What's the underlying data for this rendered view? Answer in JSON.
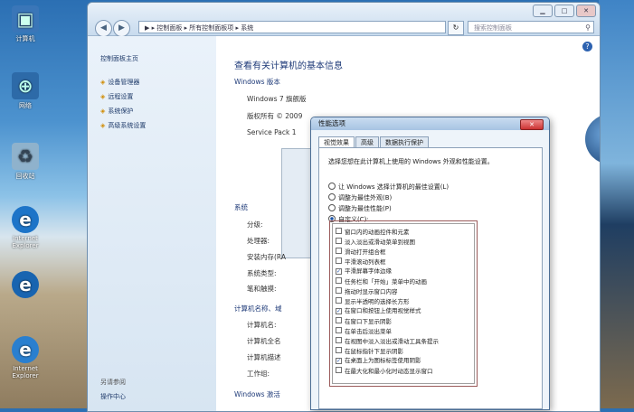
{
  "desktop": {
    "icons": [
      {
        "label": "计算机",
        "icon": "computer-icon"
      },
      {
        "label": "网络",
        "icon": "network-icon"
      },
      {
        "label": "回收站",
        "icon": "recycle-bin-icon"
      },
      {
        "label": "Internet Explorer",
        "icon": "ie-icon"
      },
      {
        "label": "",
        "icon": "ie-icon"
      },
      {
        "label": "Internet Explorer",
        "icon": "ie-icon"
      }
    ]
  },
  "window": {
    "buttons": {
      "minimize": "▁",
      "maximize": "□",
      "close": "✕"
    },
    "address": "▶ ▸ 控制面板 ▸ 所有控制面板项 ▸ 系统",
    "refresh": "↻",
    "search_placeholder": "搜索控制面板",
    "sidebar": {
      "home": "控制面板主页",
      "items": [
        "设备管理器",
        "远程设置",
        "系统保护",
        "高级系统设置"
      ],
      "see_also": "另请参阅",
      "action_center": "操作中心"
    },
    "main": {
      "title": "查看有关计算机的基本信息",
      "edition_heading": "Windows 版本",
      "edition": "Windows 7 旗舰版",
      "copyright": "版权所有 © 2009",
      "service_pack": "Service Pack 1",
      "system_heading": "系统",
      "system_rows": [
        "分级:",
        "处理器:",
        "安装内存(RA",
        "系统类型:",
        "笔和触摸:"
      ],
      "computer_heading": "计算机名称、域",
      "computer_rows": [
        "计算机名:",
        "计算机全名",
        "计算机描述",
        "工作组:"
      ],
      "activation_heading": "Windows 激活"
    }
  },
  "dialog": {
    "title": "性能选项",
    "close": "✕",
    "tabs": [
      "视觉效果",
      "高级",
      "数据执行保护"
    ],
    "intro": "选择您想在此计算机上使用的 Windows 外观和性能设置。",
    "radios": [
      {
        "label": "让 Windows 选择计算机的最佳设置(L)",
        "selected": false
      },
      {
        "label": "调整为最佳外观(B)",
        "selected": false
      },
      {
        "label": "调整为最佳性能(P)",
        "selected": false
      },
      {
        "label": "自定义(C):",
        "selected": true
      }
    ],
    "options": [
      {
        "label": "窗口内的动画控件和元素",
        "checked": false
      },
      {
        "label": "淡入淡出或滑动菜单到视图",
        "checked": false
      },
      {
        "label": "滑动打开组合框",
        "checked": false
      },
      {
        "label": "平滑滚动列表框",
        "checked": false
      },
      {
        "label": "平滑屏幕字体边缘",
        "checked": true
      },
      {
        "label": "任务栏和「开始」菜单中的动画",
        "checked": false
      },
      {
        "label": "拖动时显示窗口内容",
        "checked": false
      },
      {
        "label": "显示半透明的选择长方形",
        "checked": false
      },
      {
        "label": "在窗口和按钮上使用视觉样式",
        "checked": true
      },
      {
        "label": "在窗口下显示阴影",
        "checked": false
      },
      {
        "label": "在单击后淡出菜单",
        "checked": false
      },
      {
        "label": "在视图中淡入淡出或滑动工具条提示",
        "checked": false
      },
      {
        "label": "在鼠标指针下显示阴影",
        "checked": false
      },
      {
        "label": "在桌面上为图标标签使用阴影",
        "checked": true
      },
      {
        "label": "在最大化和最小化时动态显示窗口",
        "checked": false
      }
    ]
  }
}
